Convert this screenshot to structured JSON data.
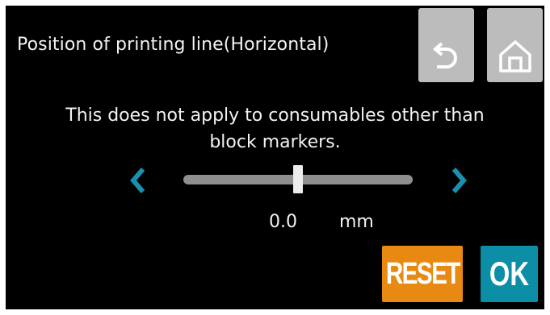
{
  "header": {
    "title": "Position of printing line(Horizontal)",
    "back_icon": "back-arrow-icon",
    "home_icon": "home-icon"
  },
  "message": {
    "line1": "This does not apply to consumables other than",
    "line2": "block markers."
  },
  "adjuster": {
    "value": "0.0",
    "unit": "mm",
    "position_fraction": 0.5,
    "left_icon": "chevron-left-icon",
    "right_icon": "chevron-right-icon"
  },
  "buttons": {
    "reset_label": "RESET",
    "ok_label": "OK"
  },
  "colors": {
    "background": "#000000",
    "icon_button": "#bcbcbc",
    "arrow": "#1a8fb0",
    "track": "#8f8f8f",
    "thumb": "#ececec",
    "reset": "#e88a11",
    "ok": "#0c8ea7"
  }
}
